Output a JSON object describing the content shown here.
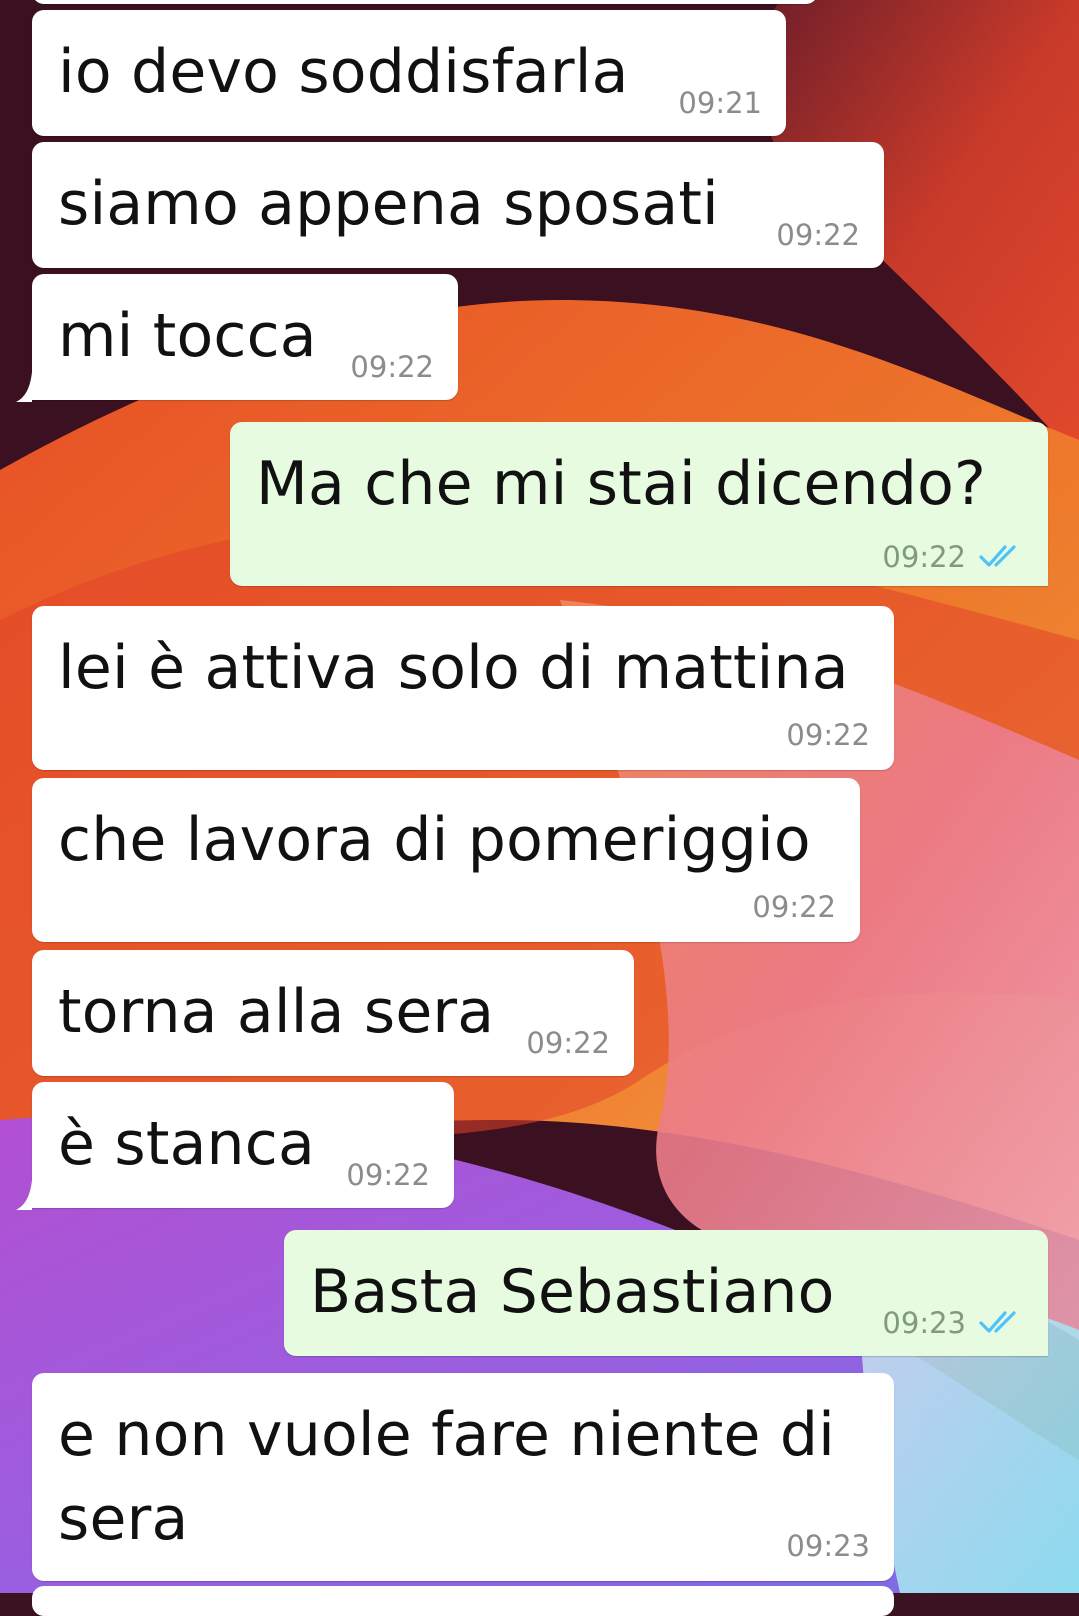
{
  "colors": {
    "incoming_bubble": "#ffffff",
    "outgoing_bubble": "#e7fbe1",
    "read_ticks": "#4fc3f7",
    "timestamp": "#8c8c8c"
  },
  "messages": [
    {
      "direction": "incoming",
      "text": "io devo soddisfarla",
      "time": "09:21"
    },
    {
      "direction": "incoming",
      "text": "siamo appena sposati",
      "time": "09:22"
    },
    {
      "direction": "incoming",
      "text": "mi tocca",
      "time": "09:22"
    },
    {
      "direction": "outgoing",
      "text": "Ma che mi stai dicendo?",
      "time": "09:22",
      "status_icon": "double-check-read-icon"
    },
    {
      "direction": "incoming",
      "text": "lei è attiva solo di mattina",
      "time": "09:22"
    },
    {
      "direction": "incoming",
      "text": "che lavora di pomeriggio",
      "time": "09:22"
    },
    {
      "direction": "incoming",
      "text": "torna alla sera",
      "time": "09:22"
    },
    {
      "direction": "incoming",
      "text": "è stanca",
      "time": "09:22"
    },
    {
      "direction": "outgoing",
      "text": "Basta Sebastiano",
      "time": "09:23",
      "status_icon": "double-check-read-icon"
    },
    {
      "direction": "incoming",
      "text": "e non vuole fare niente di sera",
      "time": "09:23"
    }
  ]
}
